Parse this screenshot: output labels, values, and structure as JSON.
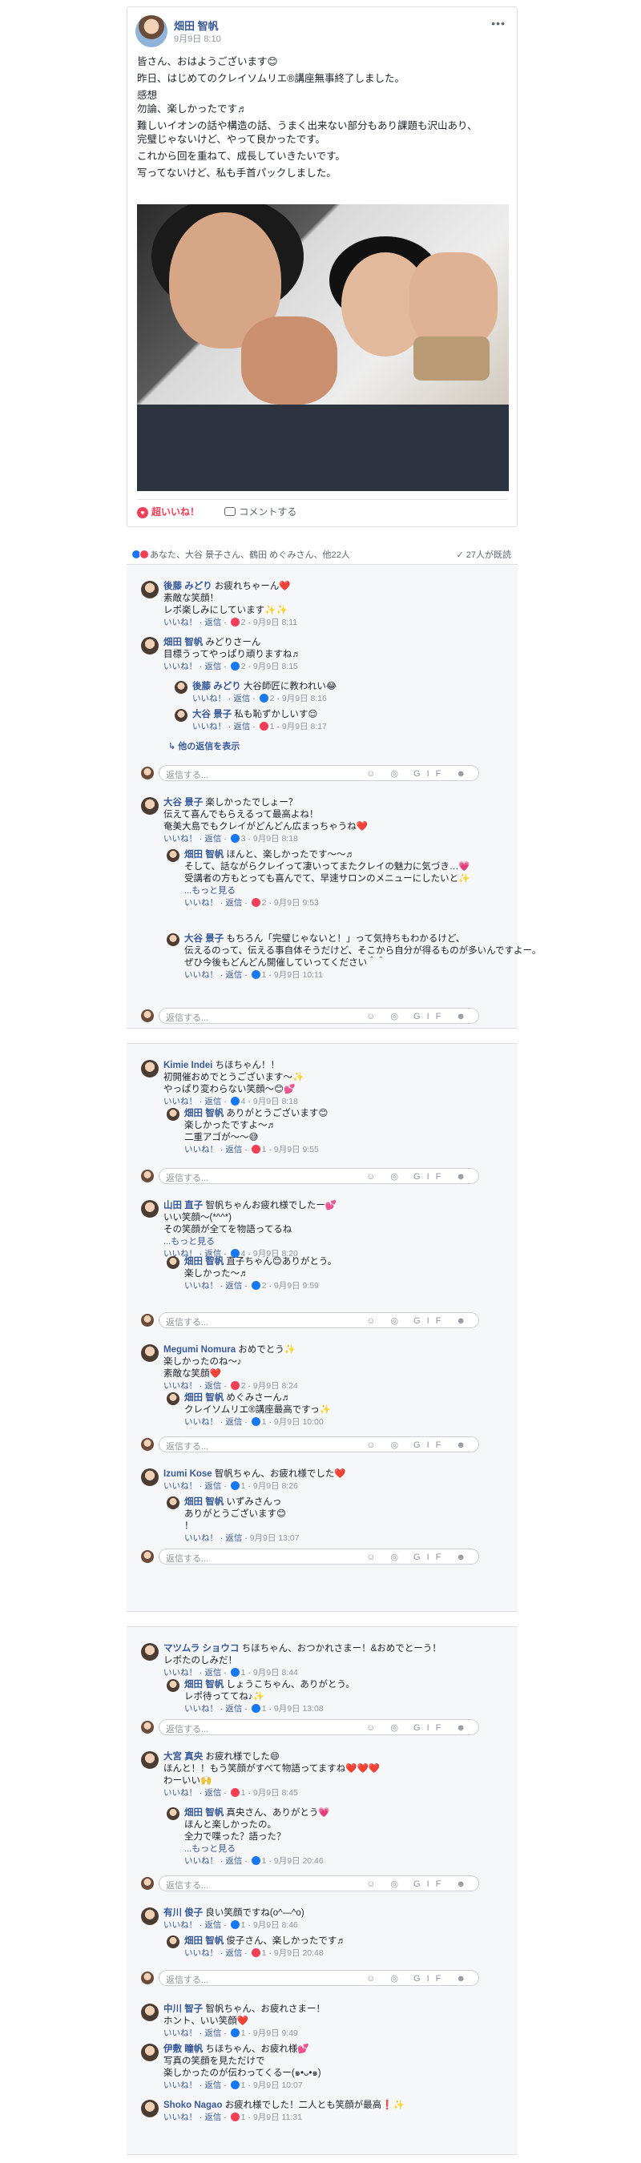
{
  "post": {
    "author": "畑田 智帆",
    "time": "9月9日 8:10",
    "more": "•••",
    "lines": [
      "皆さん、おはようございます😊",
      "昨日、はじめてのクレイソムリエ®講座無事終了しました。",
      "感想",
      "勿論、楽しかったです♬",
      "難しいイオンの話や構造の話、うまく出来ない部分もあり課題も沢山あり、",
      "完璧じゃないけど、やって良かったです。",
      "これから回を重ねて、成長していきたいです。",
      "写ってないけど、私も手首パックしました。"
    ],
    "like_label": "超いいね！",
    "comment_label": "コメントする"
  },
  "reactions": {
    "summary": "あなた、大谷 景子さん、鶴田 めぐみさん、他22人",
    "seen": "✓ 27人が既読"
  },
  "reply_placeholder": "返信する...",
  "tools": "☺ ◎ GIF ☻",
  "comments": [
    {
      "name": "後藤 みどり",
      "text": "お疲れちゃーん❤️",
      "l2": "素敵な笑顔！",
      "l3": "レポ楽しみにしています✨✨",
      "meta": "いいね！ · 返信 · ",
      "n": "2",
      "time": "9月9日 8:11"
    },
    {
      "name": "畑田 智帆",
      "text": "みどりさーん",
      "l2": "目標うってやっぱり頑りますね♬",
      "meta": "いいね！ · 返信 · ",
      "n": "2",
      "time": "9月9日 8:15"
    },
    {
      "name": "後藤 みどり",
      "text": "大谷師匠に教われい😂",
      "meta": "いいね！ · 返信 · ",
      "n": "2",
      "time": "9月9日 8:16"
    },
    {
      "name": "大谷 景子",
      "text": "私も恥ずかしいす😌",
      "meta": "いいね！ · 返信 · ",
      "n": "1",
      "time": "9月9日 8:17"
    },
    {
      "view": "↳ 他の返信を表示"
    },
    {
      "name": "大谷 景子",
      "text": "楽しかったでしょー？",
      "l2": "伝えて喜んでもらえるって最高よね！",
      "l3": "奄美大島でもクレイがどんどん広まっちゃうね❤️",
      "meta": "いいね！ · 返信 · ",
      "n": "3",
      "time": "9月9日 8:18"
    },
    {
      "name": "畑田 智帆",
      "text": "ほんと、楽しかったです〜〜♬",
      "l2": "そして、話ながらクレイって凄いってまたクレイの魅力に気づき…💗",
      "l3": "受講者の方もとっても喜んでて、早速サロンのメニューにしたいと✨",
      "more": "...もっと見る",
      "meta": "いいね！ · 返信 · ",
      "n": "2",
      "time": "9月9日 9:53"
    },
    {
      "name": "大谷 景子",
      "text": "もちろん「完璧じゃないと！」って気持ちもわかるけど、",
      "l2": "伝えるのって、伝える事自体そうだけど、そこから自分が得るものが多いんですよー。",
      "l3": "ぜひ今後もどんどん開催していってください＾＾",
      "meta": "いいね！ · 返信 · ",
      "n": "1",
      "time": "9月9日 10:11"
    },
    {
      "name": "Kimie Indei",
      "text": "ちほちゃん！！",
      "l2": "初開催おめでとうございます〜✨",
      "l3": "やっぱり変わらない笑顔〜😊💕",
      "meta": "いいね！ · 返信 · ",
      "n": "4",
      "time": "9月9日 8:18"
    },
    {
      "name": "畑田 智帆",
      "text": "ありがとうございます😊",
      "l2": "楽しかったですよ〜♬",
      "l3": "二重アゴが〜〜😅",
      "meta": "いいね！ · 返信 · ",
      "n": "1",
      "time": "9月9日 9:55"
    },
    {
      "name": "山田 直子",
      "text": "智帆ちゃんお疲れ様でしたー💕",
      "l2": "いい笑顔〜(*^^*)",
      "l3": "その笑顔が全てを物語ってるね",
      "more": "...もっと見る",
      "meta": "いいね！ · 返信 · ",
      "n": "4",
      "time": "9月9日 8:20"
    },
    {
      "name": "畑田 智帆",
      "text": "直子ちゃん😊ありがとう。",
      "l2": "楽しかった〜♬",
      "meta": "いいね！ · 返信 · ",
      "n": "2",
      "time": "9月9日 9:59"
    },
    {
      "name": "Megumi Nomura",
      "text": "おめでとう✨",
      "l2": "楽しかったのね〜♪",
      "l3": "素敵な笑顔❤️",
      "meta": "いいね！ · 返信 · ",
      "n": "2",
      "time": "9月9日 8:24"
    },
    {
      "name": "畑田 智帆",
      "text": "めぐみさーん♬",
      "l2": "クレイソムリエ®講座最高ですっ✨",
      "meta": "いいね！ · 返信 · ",
      "n": "1",
      "time": "9月9日 10:00"
    },
    {
      "name": "Izumi Kose",
      "text": "智帆ちゃん、お疲れ様でした❤️",
      "meta": "いいね！ · 返信 · ",
      "n": "1",
      "time": "9月9日 8:26"
    },
    {
      "name": "畑田 智帆",
      "text": "いずみさんっ",
      "l2": "ありがとうございます😊",
      "l3": "！",
      "meta": "いいね！ · 返信 · ",
      "n": "",
      "time": "9月9日 13:07"
    },
    {
      "name": "マツムラ ショウコ",
      "text": "ちほちゃん、おつかれさまー！&おめでとーう！",
      "l2": "レポたのしみだ！",
      "meta": "いいね！ · 返信 · ",
      "n": "1",
      "time": "9月9日 8:44"
    },
    {
      "name": "畑田 智帆",
      "text": "しょうこちゃん、ありがとう。",
      "l2": "レポ待っててね♪✨",
      "meta": "いいね！ · 返信 · ",
      "n": "1",
      "time": "9月9日 13:08"
    },
    {
      "name": "大宮 真央",
      "text": "お疲れ様でした😄",
      "l2": "ほんと！！もう笑顔がすべて物語ってますね❤️❤️❤️",
      "l3": "わーいい🙌",
      "meta": "いいね！ · 返信 · ",
      "n": "1",
      "time": "9月9日 8:45"
    },
    {
      "name": "畑田 智帆",
      "text": "真央さん、ありがとう💗",
      "l2": "ほんと楽しかったの。",
      "l3": "全力で喋った？語った？",
      "more": "...もっと見る",
      "meta": "いいね！ · 返信 · ",
      "n": "1",
      "time": "9月9日 20:46"
    },
    {
      "name": "有川 俊子",
      "text": "良い笑顔ですね(o^―^o)",
      "meta": "いいね！ · 返信 · ",
      "n": "1",
      "time": "9月9日 8:46"
    },
    {
      "name": "畑田 智帆",
      "text": "俊子さん、楽しかったです♬",
      "meta": "いいね！ · 返信 · ",
      "n": "1",
      "time": "9月9日 20:48"
    },
    {
      "name": "中川 智子",
      "text": "智帆ちゃん、お疲れさまー！",
      "l2": "ホント、いい笑顔❤️",
      "meta": "いいね！ · 返信 · ",
      "n": "1",
      "time": "9月9日 9:49"
    },
    {
      "name": "伊敷 瞳帆",
      "text": "ちほちゃん、お疲れ様💕",
      "l2": "写真の笑顔を見ただけで",
      "l3": "楽しかったのが伝わってくるー(๑•ᴗ•๑)",
      "meta": "いいね！ · 返信 · ",
      "n": "1",
      "time": "9月9日 10:07"
    },
    {
      "name": "Shoko Nagao",
      "text": "お疲れ様でした！二人とも笑顔が最高❗✨",
      "meta": "いいね！ · 返信 · ",
      "n": "1",
      "time": "9月9日 11:31"
    }
  ],
  "colors": {
    "link": "#385898",
    "love": "#f33e58",
    "like": "#1877f2",
    "bg": "#f6f7f9"
  }
}
